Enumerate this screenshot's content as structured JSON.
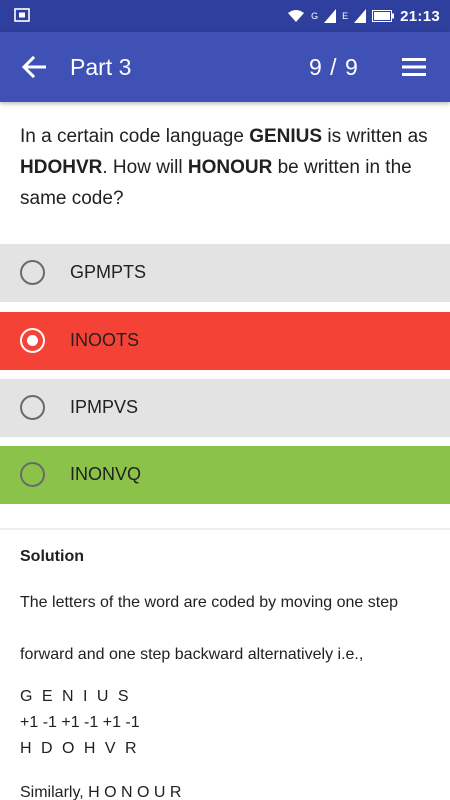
{
  "status_bar": {
    "network_label": "G",
    "network_label_2": "E",
    "time": "21:13"
  },
  "app_bar": {
    "title": "Part 3",
    "progress": "9 / 9"
  },
  "question": {
    "part1": "In a certain code language ",
    "word1": "GENIUS",
    "part2": " is written as ",
    "word2": "HDOHVR",
    "part3": ". How will ",
    "word3": "HONOUR",
    "part4": " be written in the same code?"
  },
  "options": [
    {
      "label": "GPMPTS",
      "state": "neutral"
    },
    {
      "label": "INOOTS",
      "state": "wrong-selected"
    },
    {
      "label": "IPMPVS",
      "state": "neutral"
    },
    {
      "label": "INONVQ",
      "state": "correct"
    }
  ],
  "colors": {
    "status_bar": "#2f3f9e",
    "app_bar": "#3f51b5",
    "option_neutral": "#e3e3e3",
    "option_wrong": "#f44336",
    "option_correct": "#8bc34a"
  },
  "icons": {
    "status_left": "screenshot-icon",
    "back": "arrow-back-icon",
    "menu": "menu-icon"
  },
  "solution": {
    "title": "Solution",
    "line1": "The letters of the word are coded by moving one step",
    "line2": "forward and one step backward alternatively i.e.,",
    "line3": "G E N I U S",
    "line4": "+1 -1 +1 -1 +1 -1",
    "line5": "H D O H V R",
    "line6": "Similarly, H O N O U R"
  }
}
